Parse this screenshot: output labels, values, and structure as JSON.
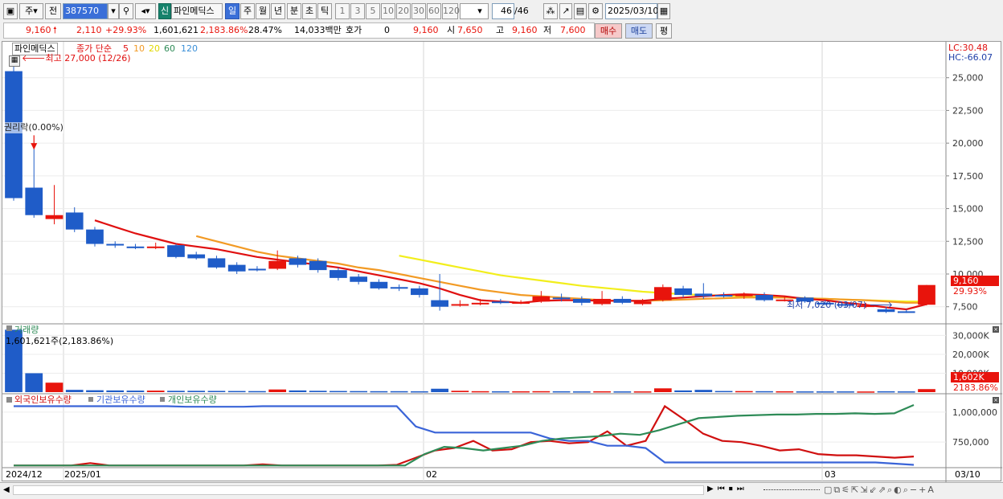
{
  "toolbar": {
    "mode_label": "주",
    "prev_label": "전",
    "code": "387570",
    "stock_badge": "신",
    "stock_name": "파인메딕스",
    "periods": [
      "일",
      "주",
      "월",
      "년",
      "분",
      "초",
      "틱"
    ],
    "intervals": [
      "1",
      "3",
      "5",
      "10",
      "20",
      "30",
      "60",
      "120"
    ],
    "count": "46",
    "count_total": "/46",
    "date": "2025/03/10"
  },
  "quote": {
    "price": "9,160",
    "change": "2,110",
    "change_pct": "+29.93%",
    "volume": "1,601,621",
    "volume_pct": "2,183.86%",
    "turnover_pct": "28.47%",
    "amount": "14,033백만",
    "hoga_label": "호가",
    "hoga_value": "0",
    "hoga_price": "9,160",
    "open_label": "시",
    "open": "7,650",
    "high_label": "고",
    "high": "9,160",
    "low_label": "저",
    "low": "7,600",
    "buy_label": "매수",
    "sell_label": "매도",
    "eval_label": "평"
  },
  "price_panel": {
    "legend_name": "파인메딕스",
    "legend_ma": "종가 단순",
    "ma_periods": [
      "5",
      "10",
      "20",
      "60",
      "120"
    ],
    "max_note": "최고 27,000 (12/26)",
    "ex_note": "권리락(0.00%)",
    "min_note": "최저 7,020 (03/07)",
    "lc": "LC:30.48",
    "hc": "HC:-66.07",
    "last_tag": "9,160",
    "last_pct": "29.93%"
  },
  "volume_panel": {
    "title": "거래량",
    "note": "1,601,621주(2,183.86%)",
    "last_tag": "1,602K",
    "last_pct": "2183.86%"
  },
  "holding_panel": {
    "legend": [
      "외국인보유수량",
      "기관보유수량",
      "개인보유수량"
    ]
  },
  "xaxis": {
    "labels": [
      "2024/12",
      "2025/01",
      "02",
      "03",
      "03/10"
    ]
  },
  "colors": {
    "up": "#e8140c",
    "down": "#1f5cc8",
    "ma5": "#e01010",
    "ma10": "#f29a24",
    "ma20": "#f2ee1c",
    "ma60": "#2e8b57",
    "ma120": "#3a8fd8",
    "foreign": "#d01010",
    "inst": "#3a64d8",
    "indiv": "#2e8b57"
  },
  "chart_data": [
    {
      "type": "candlestick",
      "y_ticks": [
        "7,500",
        "10,000",
        "12,500",
        "15,000",
        "17,500",
        "20,000",
        "22,500",
        "25,000"
      ],
      "ylim": [
        6500,
        27500
      ],
      "candles": [
        {
          "o": 25500,
          "c": 15800,
          "h": 27000,
          "l": 15600
        },
        {
          "o": 16600,
          "c": 14500,
          "h": 19700,
          "l": 14300
        },
        {
          "o": 14200,
          "c": 14500,
          "h": 16800,
          "l": 13800
        },
        {
          "o": 14700,
          "c": 13400,
          "h": 15100,
          "l": 13200
        },
        {
          "o": 13400,
          "c": 12300,
          "h": 13600,
          "l": 12100
        },
        {
          "o": 12300,
          "c": 12200,
          "h": 12500,
          "l": 12000
        },
        {
          "o": 12100,
          "c": 12050,
          "h": 12300,
          "l": 11900
        },
        {
          "o": 12000,
          "c": 12100,
          "h": 12400,
          "l": 11900
        },
        {
          "o": 12200,
          "c": 11300,
          "h": 12300,
          "l": 11200
        },
        {
          "o": 11500,
          "c": 11200,
          "h": 11700,
          "l": 11100
        },
        {
          "o": 11200,
          "c": 10500,
          "h": 11400,
          "l": 10400
        },
        {
          "o": 10700,
          "c": 10200,
          "h": 10900,
          "l": 10000
        },
        {
          "o": 10400,
          "c": 10350,
          "h": 10600,
          "l": 10200
        },
        {
          "o": 10400,
          "c": 11000,
          "h": 11800,
          "l": 10300
        },
        {
          "o": 11200,
          "c": 10700,
          "h": 11400,
          "l": 10500
        },
        {
          "o": 11000,
          "c": 10300,
          "h": 11200,
          "l": 10100
        },
        {
          "o": 10300,
          "c": 9700,
          "h": 10500,
          "l": 9500
        },
        {
          "o": 9800,
          "c": 9400,
          "h": 10000,
          "l": 9200
        },
        {
          "o": 9400,
          "c": 8900,
          "h": 9600,
          "l": 8800
        },
        {
          "o": 9000,
          "c": 8900,
          "h": 9200,
          "l": 8700
        },
        {
          "o": 8900,
          "c": 8400,
          "h": 9100,
          "l": 8200
        },
        {
          "o": 8000,
          "c": 7500,
          "h": 10000,
          "l": 7200
        },
        {
          "o": 7600,
          "c": 7700,
          "h": 8000,
          "l": 7500
        },
        {
          "o": 7700,
          "c": 7800,
          "h": 8100,
          "l": 7600
        },
        {
          "o": 7900,
          "c": 7800,
          "h": 8100,
          "l": 7700
        },
        {
          "o": 7800,
          "c": 7850,
          "h": 8000,
          "l": 7700
        },
        {
          "o": 7900,
          "c": 8300,
          "h": 8700,
          "l": 7800
        },
        {
          "o": 8200,
          "c": 8100,
          "h": 8500,
          "l": 7900
        },
        {
          "o": 8100,
          "c": 7800,
          "h": 8300,
          "l": 7600
        },
        {
          "o": 7700,
          "c": 8100,
          "h": 8700,
          "l": 7600
        },
        {
          "o": 8100,
          "c": 7800,
          "h": 8300,
          "l": 7700
        },
        {
          "o": 7700,
          "c": 7900,
          "h": 8100,
          "l": 7600
        },
        {
          "o": 8000,
          "c": 9000,
          "h": 9200,
          "l": 7900
        },
        {
          "o": 8900,
          "c": 8400,
          "h": 9100,
          "l": 8200
        },
        {
          "o": 8500,
          "c": 8300,
          "h": 9300,
          "l": 8100
        },
        {
          "o": 8400,
          "c": 8300,
          "h": 8600,
          "l": 8200
        },
        {
          "o": 8300,
          "c": 8500,
          "h": 8600,
          "l": 8100
        },
        {
          "o": 8400,
          "c": 8000,
          "h": 8600,
          "l": 7900
        },
        {
          "o": 8000,
          "c": 8050,
          "h": 8300,
          "l": 7900
        },
        {
          "o": 8200,
          "c": 7900,
          "h": 8300,
          "l": 7800
        },
        {
          "o": 7800,
          "c": 7700,
          "h": 8000,
          "l": 7600
        },
        {
          "o": 7700,
          "c": 7600,
          "h": 7900,
          "l": 7500
        },
        {
          "o": 7500,
          "c": 7600,
          "h": 7800,
          "l": 7400
        },
        {
          "o": 7300,
          "c": 7100,
          "h": 7500,
          "l": 7020
        },
        {
          "o": 7150,
          "c": 7050,
          "h": 7300,
          "l": 7020
        },
        {
          "o": 7650,
          "c": 9160,
          "h": 9160,
          "l": 7600
        }
      ],
      "ma5": [
        null,
        null,
        null,
        null,
        14100,
        13600,
        13100,
        12700,
        12300,
        12100,
        11900,
        11600,
        11300,
        11100,
        10900,
        10700,
        10500,
        10200,
        9900,
        9600,
        9300,
        8900,
        8400,
        8000,
        7900,
        7800,
        7950,
        8000,
        8000,
        7950,
        7950,
        7950,
        8100,
        8200,
        8300,
        8400,
        8450,
        8400,
        8300,
        8100,
        8000,
        7800,
        7650,
        7450,
        7300,
        7700
      ],
      "ma10": [
        null,
        null,
        null,
        null,
        null,
        null,
        null,
        null,
        null,
        12900,
        12500,
        12100,
        11700,
        11400,
        11200,
        11000,
        10800,
        10500,
        10300,
        10000,
        9700,
        9400,
        9100,
        8800,
        8600,
        8400,
        8300,
        8200,
        8100,
        8000,
        7950,
        7950,
        8000,
        8050,
        8100,
        8150,
        8200,
        8200,
        8200,
        8150,
        8100,
        8050,
        8000,
        7900,
        7800,
        7800
      ],
      "ma20": [
        null,
        null,
        null,
        null,
        null,
        null,
        null,
        null,
        null,
        null,
        null,
        null,
        null,
        null,
        null,
        null,
        null,
        null,
        null,
        11400,
        11100,
        10800,
        10500,
        10200,
        9900,
        9700,
        9500,
        9300,
        9100,
        8950,
        8800,
        8650,
        8550,
        8450,
        8400,
        8350,
        8300,
        8250,
        8200,
        8150,
        8100,
        8050,
        8000,
        7950,
        7900,
        7900
      ]
    },
    {
      "type": "bar",
      "name": "거래량",
      "y_ticks": [
        "10,000K",
        "20,000K",
        "30,000K"
      ],
      "ylim": [
        0,
        34000
      ],
      "values": [
        33000,
        10000,
        5000,
        1200,
        1000,
        900,
        800,
        800,
        700,
        700,
        650,
        600,
        550,
        1400,
        900,
        700,
        600,
        550,
        500,
        500,
        450,
        1800,
        700,
        500,
        450,
        450,
        500,
        450,
        400,
        450,
        400,
        400,
        2000,
        900,
        1200,
        600,
        550,
        500,
        450,
        400,
        400,
        400,
        350,
        450,
        400,
        1602
      ]
    },
    {
      "type": "line",
      "y_ticks": [
        "750,000",
        "1,000,000"
      ],
      "ylim": [
        550000,
        1100000
      ],
      "series": [
        {
          "name": "외국인보유수량",
          "values": [
            555000,
            555000,
            555000,
            555000,
            575000,
            555000,
            555000,
            555000,
            555000,
            555000,
            555000,
            555000,
            555000,
            565000,
            555000,
            555000,
            555000,
            555000,
            555000,
            555000,
            560000,
            620000,
            680000,
            700000,
            760000,
            680000,
            690000,
            750000,
            760000,
            740000,
            750000,
            840000,
            720000,
            760000,
            1050000,
            940000,
            820000,
            760000,
            750000,
            720000,
            680000,
            690000,
            650000,
            640000,
            640000,
            630000,
            620000,
            630000
          ]
        },
        {
          "name": "기관보유수량",
          "values": [
            1050000,
            1050000,
            1050000,
            1050000,
            1050000,
            1050000,
            1050000,
            1050000,
            1050000,
            1045000,
            1045000,
            1045000,
            1045000,
            1050000,
            1050000,
            1050000,
            1050000,
            1050000,
            1050000,
            1050000,
            1050000,
            880000,
            830000,
            830000,
            830000,
            830000,
            830000,
            830000,
            780000,
            760000,
            760000,
            720000,
            720000,
            700000,
            580000,
            580000,
            580000,
            580000,
            580000,
            580000,
            580000,
            580000,
            580000,
            580000,
            580000,
            580000,
            570000,
            560000
          ]
        },
        {
          "name": "개인보유수량",
          "values": [
            555000,
            555000,
            555000,
            555000,
            555000,
            555000,
            555000,
            555000,
            555000,
            555000,
            555000,
            555000,
            555000,
            555000,
            555000,
            555000,
            555000,
            555000,
            555000,
            555000,
            555000,
            650000,
            710000,
            700000,
            680000,
            700000,
            720000,
            760000,
            780000,
            790000,
            800000,
            820000,
            810000,
            850000,
            900000,
            950000,
            960000,
            970000,
            975000,
            980000,
            980000,
            985000,
            985000,
            990000,
            985000,
            990000,
            1060000
          ]
        }
      ]
    }
  ]
}
